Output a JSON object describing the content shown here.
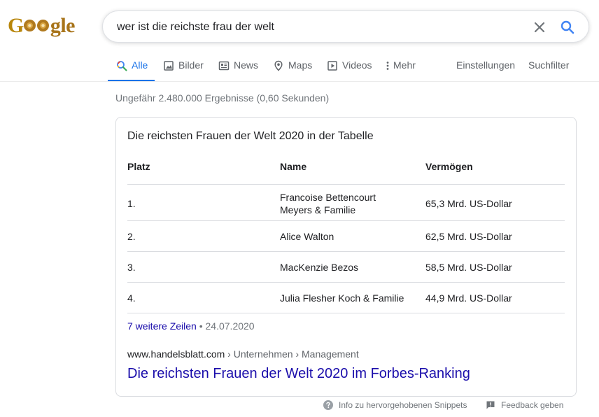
{
  "logo": {
    "text_before": "G",
    "text_after": "gle"
  },
  "search": {
    "query": "wer ist die reichste frau der welt",
    "placeholder": ""
  },
  "tabs": [
    {
      "label": "Alle",
      "icon": "search-icon",
      "active": true
    },
    {
      "label": "Bilder",
      "icon": "image-icon",
      "active": false
    },
    {
      "label": "News",
      "icon": "news-icon",
      "active": false
    },
    {
      "label": "Maps",
      "icon": "map-pin-icon",
      "active": false
    },
    {
      "label": "Videos",
      "icon": "play-icon",
      "active": false
    },
    {
      "label": "Mehr",
      "icon": "more-vert-icon",
      "active": false
    }
  ],
  "tools": {
    "settings": "Einstellungen",
    "filter": "Suchfilter"
  },
  "stats": "Ungefähr 2.480.000 Ergebnisse (0,60 Sekunden)",
  "snippet": {
    "title": "Die reichsten Frauen der Welt 2020 in der Tabelle",
    "headers": [
      "Platz",
      "Name",
      "Vermögen"
    ],
    "rows": [
      {
        "rank": "1.",
        "name_line1": "Francoise Bettencourt",
        "name_line2": "Meyers & Familie",
        "wealth": "65,3 Mrd. US-Dollar"
      },
      {
        "rank": "2.",
        "name_line1": "Alice Walton",
        "name_line2": "",
        "wealth": "62,5 Mrd. US-Dollar"
      },
      {
        "rank": "3.",
        "name_line1": "MacKenzie Bezos",
        "name_line2": "",
        "wealth": "58,5 Mrd. US-Dollar"
      },
      {
        "rank": "4.",
        "name_line1": "Julia Flesher Koch & Familie",
        "name_line2": "",
        "wealth": "44,9 Mrd. US-Dollar"
      }
    ],
    "more_rows": "7 weitere Zeilen",
    "separator": "•",
    "date": "24.07.2020",
    "source_domain": "www.handelsblatt.com",
    "source_path": " › Unternehmen › Management",
    "result_title": "Die reichsten Frauen der Welt 2020 im Forbes-Ranking"
  },
  "footer": {
    "info": "Info zu hervorgehobenen Snippets",
    "feedback": "Feedback geben"
  },
  "colors": {
    "accent": "#1a73e8",
    "link": "#1a0dab",
    "logo": "#a8741a"
  }
}
